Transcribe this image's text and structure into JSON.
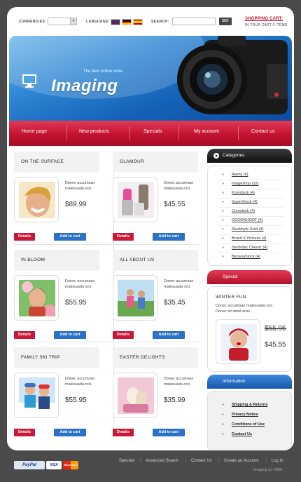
{
  "topbar": {
    "currencies_label": "Currencies:",
    "language_label": "Language:",
    "search_label": "Search:",
    "search_value": "",
    "go_label": "GO!",
    "cart_title": "Shopping Cart:",
    "cart_sub": "In your cart 0 items"
  },
  "banner": {
    "tagline": "The best online store",
    "logo": "Imaging"
  },
  "nav": [
    "Home page",
    "New products",
    "Specials",
    "My account",
    "Contact us"
  ],
  "products": [
    {
      "title": "On the surface",
      "desc": "Donec accumsan malesuada orci.",
      "price": "$89.99"
    },
    {
      "title": "Glamour",
      "desc": "Donec accumsan malesuada orci.",
      "price": "$45.55"
    },
    {
      "title": "In bloom",
      "desc": "Donec accumsan malesuada orci.",
      "price": "$55.95"
    },
    {
      "title": "All about us",
      "desc": "Donec accumsan malesuada orci.",
      "price": "$35.45"
    },
    {
      "title": "Family ski trip",
      "desc": "Donec accumsan malesuada orci.",
      "price": "$55.95"
    },
    {
      "title": "Easter delights",
      "desc": "Donec accumsan malesuada orci.",
      "price": "$35.99"
    }
  ],
  "buttons": {
    "details": "Details",
    "add_to_cart": "Add to cart"
  },
  "categories": {
    "title": "Categories",
    "items": [
      "Alamy (4)",
      "Imageshop (12)",
      "Purestock (4)",
      "SuperStock (4)",
      "Corestock (4)",
      "GOODSHOOT (4)",
      "Stockbyte Gold (4)",
      "Brand X Pictures (4)",
      "Stockdisc Classic (4)",
      "BananaStock (4)"
    ]
  },
  "special": {
    "title": "Special",
    "product_title": "Winter fun",
    "desc": "Donec accumsan malesuada orci. Donec sit amet eros.",
    "old_price": "$55.95",
    "new_price": "$45.55"
  },
  "information": {
    "title": "Information",
    "items": [
      "Shipping & Returns",
      "Privacy Notice",
      "Conditions of Use",
      "Contact Us"
    ]
  },
  "footer": {
    "links": [
      "Specials",
      "Advanced Search",
      "Contact Us",
      "Create an Account",
      "Log In"
    ],
    "copyright": "Imaging (c) 2008",
    "payments": [
      "PayPal",
      "VISA",
      "MasterCard"
    ]
  },
  "colors": {
    "accent_red": "#c91838",
    "accent_blue": "#2a72c8",
    "banner_blue": "#1562b8"
  }
}
